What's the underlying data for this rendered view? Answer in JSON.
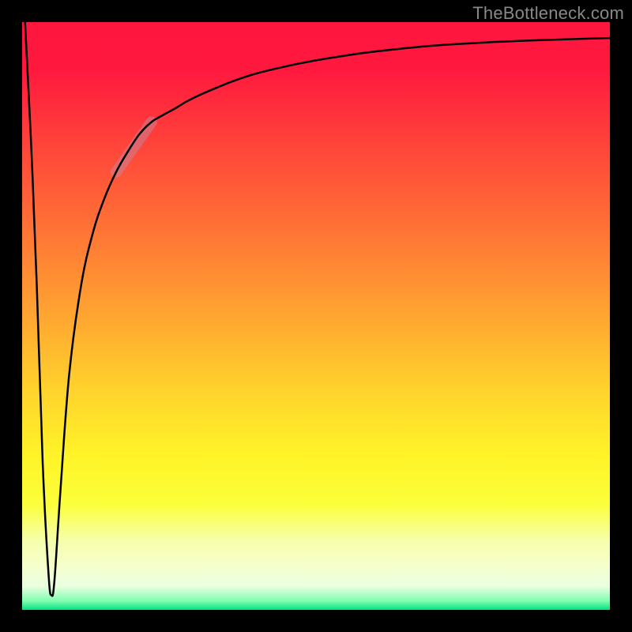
{
  "watermark": "TheBottleneck.com",
  "chart_data": {
    "type": "line",
    "title": "",
    "xlabel": "",
    "ylabel": "",
    "axes_visible": false,
    "legend": false,
    "background": "black-border-with-vertical-gradient",
    "gradient_colors_top_to_bottom": [
      "#ff163f",
      "#ffd42c",
      "#fff428",
      "#00e081"
    ],
    "xlim": [
      0,
      100
    ],
    "ylim": [
      0,
      100
    ],
    "series": [
      {
        "name": "bottleneck-curve",
        "stroke": "#000000",
        "stroke_width": 2.5,
        "x": [
          0.5,
          1.5,
          2.5,
          3.5,
          4.5,
          5.0,
          5.5,
          6.5,
          8.0,
          10,
          12,
          14,
          16,
          18,
          20,
          22,
          24,
          26,
          28,
          30,
          33,
          36,
          40,
          45,
          50,
          55,
          60,
          70,
          80,
          90,
          100
        ],
        "y": [
          100,
          80,
          55,
          25,
          6,
          2.5,
          5,
          20,
          40,
          55,
          64,
          70,
          74.5,
          78,
          81,
          83,
          84.2,
          85.3,
          86.5,
          87.5,
          88.8,
          90,
          91.3,
          92.5,
          93.5,
          94.3,
          95.0,
          96.0,
          96.6,
          97.0,
          97.3
        ]
      }
    ],
    "annotations": [
      {
        "name": "highlight-band",
        "type": "segment-overlay",
        "stroke": "rgba(200,130,150,0.55)",
        "stroke_width": 14,
        "x": [
          16,
          22
        ],
        "y": [
          74.5,
          83
        ]
      }
    ]
  }
}
